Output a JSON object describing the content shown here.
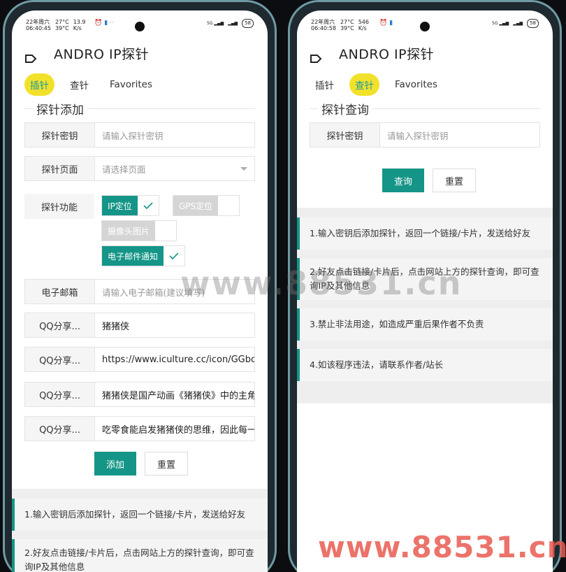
{
  "left": {
    "status": {
      "date": "22年周六",
      "time": "06:40:45",
      "temp1": "27°C",
      "temp2": "39°C",
      "speed1": "13.9",
      "speed2": "K/s",
      "battery": "58"
    },
    "app_title": "ANDRO IP探针",
    "tabs": [
      {
        "label": "插针"
      },
      {
        "label": "查针"
      },
      {
        "label": "Favorites"
      }
    ],
    "section_title": "探针添加",
    "fields": [
      {
        "label": "探针密钥",
        "value": "",
        "placeholder": "请输入探针密钥"
      },
      {
        "label": "探针页面",
        "value": "",
        "placeholder": "请选择页面"
      }
    ],
    "func_label": "探针功能",
    "toggles": [
      {
        "label": "IP定位",
        "on": true
      },
      {
        "label": "GPS定位",
        "on": false
      },
      {
        "label": "摄像头图片",
        "on": false
      },
      {
        "label": "电子邮件通知",
        "on": true
      }
    ],
    "email": {
      "label": "电子邮箱",
      "placeholder": "请输入电子邮箱(建议填写)"
    },
    "qq": [
      {
        "label": "QQ分享...",
        "value": "猪猪侠"
      },
      {
        "label": "QQ分享...",
        "value": "https://www.iculture.cc/icon/GGbon"
      },
      {
        "label": "QQ分享...",
        "value": "猪猪侠是国产动画《猪猪侠》中的主角"
      },
      {
        "label": "QQ分享...",
        "value": "吃零食能启发猪猪侠的思维，因此每一"
      }
    ],
    "buttons": {
      "add": "添加",
      "reset": "重置"
    },
    "notices": [
      "1.输入密钥后添加探针，返回一个链接/卡片，发送给好友",
      "2.好友点击链接/卡片后，点击网站上方的探针查询，即可查询IP及其他信息"
    ]
  },
  "right": {
    "status": {
      "date": "22年周六",
      "time": "06:40:58",
      "temp1": "27°C",
      "temp2": "39°C",
      "speed1": "546",
      "speed2": "K/s",
      "battery": "58"
    },
    "app_title": "ANDRO IP探针",
    "tabs": [
      {
        "label": "插针"
      },
      {
        "label": "查针"
      },
      {
        "label": "Favorites"
      }
    ],
    "section_title": "探针查询",
    "field": {
      "label": "探针密钥",
      "placeholder": "请输入探针密钥"
    },
    "buttons": {
      "query": "查询",
      "reset": "重置"
    },
    "notices": [
      "1.输入密钥后添加探针，返回一个链接/卡片，发送给好友",
      "2.好友点击链接/卡片后，点击网站上方的探针查询，即可查询IP及其他信息",
      "3.禁止非法用途，如造成严重后果作者不负责",
      "4.如该程序违法，请联系作者/站长"
    ]
  },
  "watermarks": {
    "center": "www.88531.cn",
    "corner": "www.88531.cn"
  },
  "colors": {
    "accent": "#149587",
    "tab_highlight": "#f2e12a",
    "frame": "#6f9aa3"
  }
}
